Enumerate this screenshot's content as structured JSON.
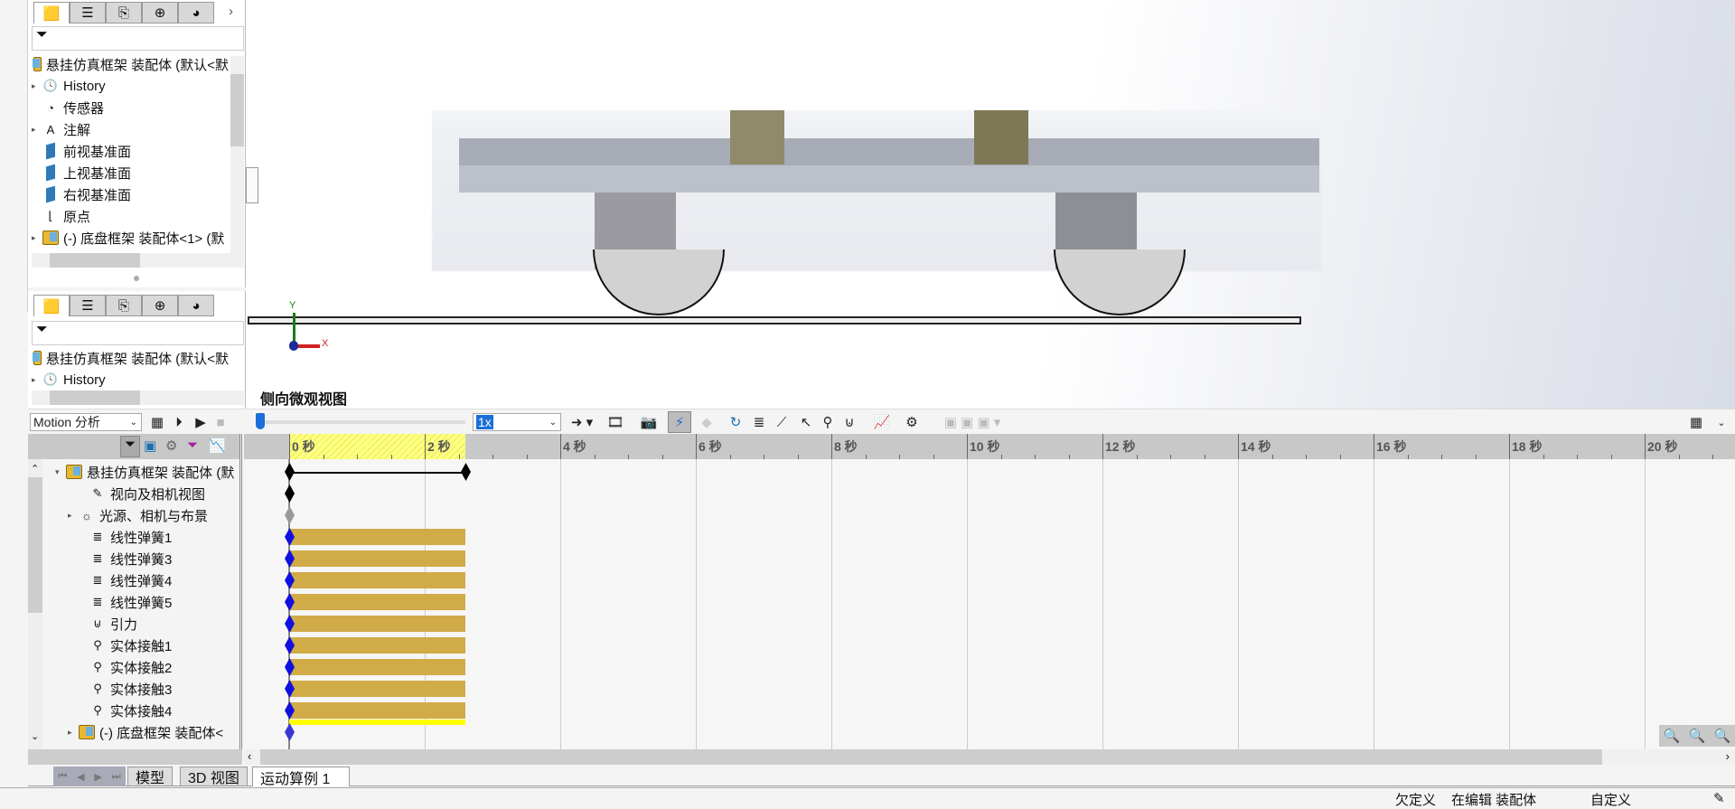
{
  "feature_manager_tabs": [
    "feature-tree-icon",
    "property-manager-icon",
    "configuration-manager-icon",
    "dimxpert-icon",
    "display-manager-icon"
  ],
  "top_panel": {
    "filter_icon": "funnel-icon",
    "tree": [
      {
        "label": "悬挂仿真框架 装配体  (默认<默",
        "icon": "assembly-icon",
        "twisty": ""
      },
      {
        "label": "History",
        "icon": "history-folder-icon",
        "twisty": "▸"
      },
      {
        "label": "传感器",
        "icon": "sensor-folder-icon",
        "twisty": ""
      },
      {
        "label": "注解",
        "icon": "annotation-folder-icon",
        "twisty": "▸"
      },
      {
        "label": "前视基准面",
        "icon": "plane-icon",
        "twisty": ""
      },
      {
        "label": "上视基准面",
        "icon": "plane-icon",
        "twisty": ""
      },
      {
        "label": "右视基准面",
        "icon": "plane-icon",
        "twisty": ""
      },
      {
        "label": "原点",
        "icon": "origin-icon",
        "twisty": ""
      },
      {
        "label": "(-) 底盘框架 装配体<1> (默",
        "icon": "assembly-icon",
        "twisty": "▸"
      }
    ]
  },
  "bottom_panel": {
    "tree": [
      {
        "label": "悬挂仿真框架 装配体  (默认<默",
        "icon": "assembly-icon",
        "twisty": ""
      },
      {
        "label": "History",
        "icon": "history-folder-icon",
        "twisty": "▸"
      }
    ]
  },
  "viewport": {
    "view_name": "侧向微观视图",
    "axis_x": "X",
    "axis_y": "Y"
  },
  "motion_toolbar": {
    "study_type": "Motion 分析",
    "playback_speed": "1x",
    "playback_progress": 0
  },
  "timeline": {
    "tick_labels": [
      "0 秒",
      "2 秒",
      "4 秒",
      "6 秒",
      "8 秒",
      "10 秒",
      "12 秒",
      "14 秒",
      "16 秒",
      "18 秒",
      "20 秒"
    ],
    "tick_values": [
      0,
      2,
      4,
      6,
      8,
      10,
      12,
      14,
      16,
      18,
      20
    ],
    "duration_s": 2.6,
    "colors": {
      "bar": "#d0ab48",
      "key": "#1010e0",
      "highlight": "#ffff00"
    },
    "rows": [
      {
        "label": "悬挂仿真框架 装配体  (默",
        "icon": "assembly-icon",
        "twisty": "▾",
        "track": "span"
      },
      {
        "label": "视向及相机视图",
        "icon": "camera-icon",
        "twisty": "",
        "track": "key-black"
      },
      {
        "label": "光源、相机与布景",
        "icon": "lights-folder-icon",
        "twisty": "▸",
        "track": "key-grey"
      },
      {
        "label": "线性弹簧1",
        "icon": "spring-icon",
        "twisty": "",
        "track": "bar"
      },
      {
        "label": "线性弹簧3",
        "icon": "spring-icon",
        "twisty": "",
        "track": "bar"
      },
      {
        "label": "线性弹簧4",
        "icon": "spring-icon",
        "twisty": "",
        "track": "bar"
      },
      {
        "label": "线性弹簧5",
        "icon": "spring-icon",
        "twisty": "",
        "track": "bar"
      },
      {
        "label": "引力",
        "icon": "gravity-icon",
        "twisty": "",
        "track": "bar"
      },
      {
        "label": "实体接触1",
        "icon": "contact-icon",
        "twisty": "",
        "track": "bar"
      },
      {
        "label": "实体接触2",
        "icon": "contact-icon",
        "twisty": "",
        "track": "bar"
      },
      {
        "label": "实体接触3",
        "icon": "contact-icon",
        "twisty": "",
        "track": "bar"
      },
      {
        "label": "实体接触4",
        "icon": "contact-icon",
        "twisty": "",
        "track": "bar"
      },
      {
        "label": "(-) 底盘框架 装配体<",
        "icon": "assembly-icon",
        "twisty": "▸",
        "track": "yellow"
      }
    ]
  },
  "bottom_tabs": [
    "模型",
    "3D 视图",
    "运动算例 1"
  ],
  "active_tab": "运动算例 1",
  "status_bar": {
    "state": "欠定义",
    "editing": "在编辑 装配体",
    "units": "自定义"
  }
}
